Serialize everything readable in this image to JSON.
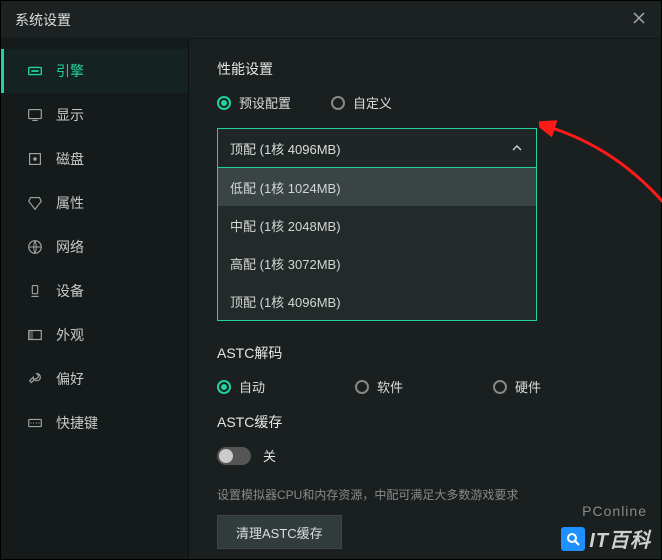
{
  "header": {
    "title": "系统设置"
  },
  "sidebar": {
    "items": [
      {
        "label": "引擎"
      },
      {
        "label": "显示"
      },
      {
        "label": "磁盘"
      },
      {
        "label": "属性"
      },
      {
        "label": "网络"
      },
      {
        "label": "设备"
      },
      {
        "label": "外观"
      },
      {
        "label": "偏好"
      },
      {
        "label": "快捷键"
      }
    ]
  },
  "main": {
    "perf": {
      "title": "性能设置",
      "preset_label": "预设配置",
      "custom_label": "自定义",
      "selected": "顶配 (1核 4096MB)",
      "options": [
        "低配 (1核 1024MB)",
        "中配 (1核 2048MB)",
        "高配 (1核 3072MB)",
        "顶配 (1核 4096MB)"
      ]
    },
    "astc_decode": {
      "title": "ASTC解码",
      "auto": "自动",
      "software": "软件",
      "hardware": "硬件"
    },
    "astc_cache": {
      "title": "ASTC缓存",
      "state": "关"
    },
    "footer_text": "设置模拟器CPU和内存资源，中配可满足大多数游戏要求",
    "clear_btn": "清理ASTC缓存"
  },
  "watermark": {
    "source": "PConline",
    "brand": "IT百科"
  }
}
